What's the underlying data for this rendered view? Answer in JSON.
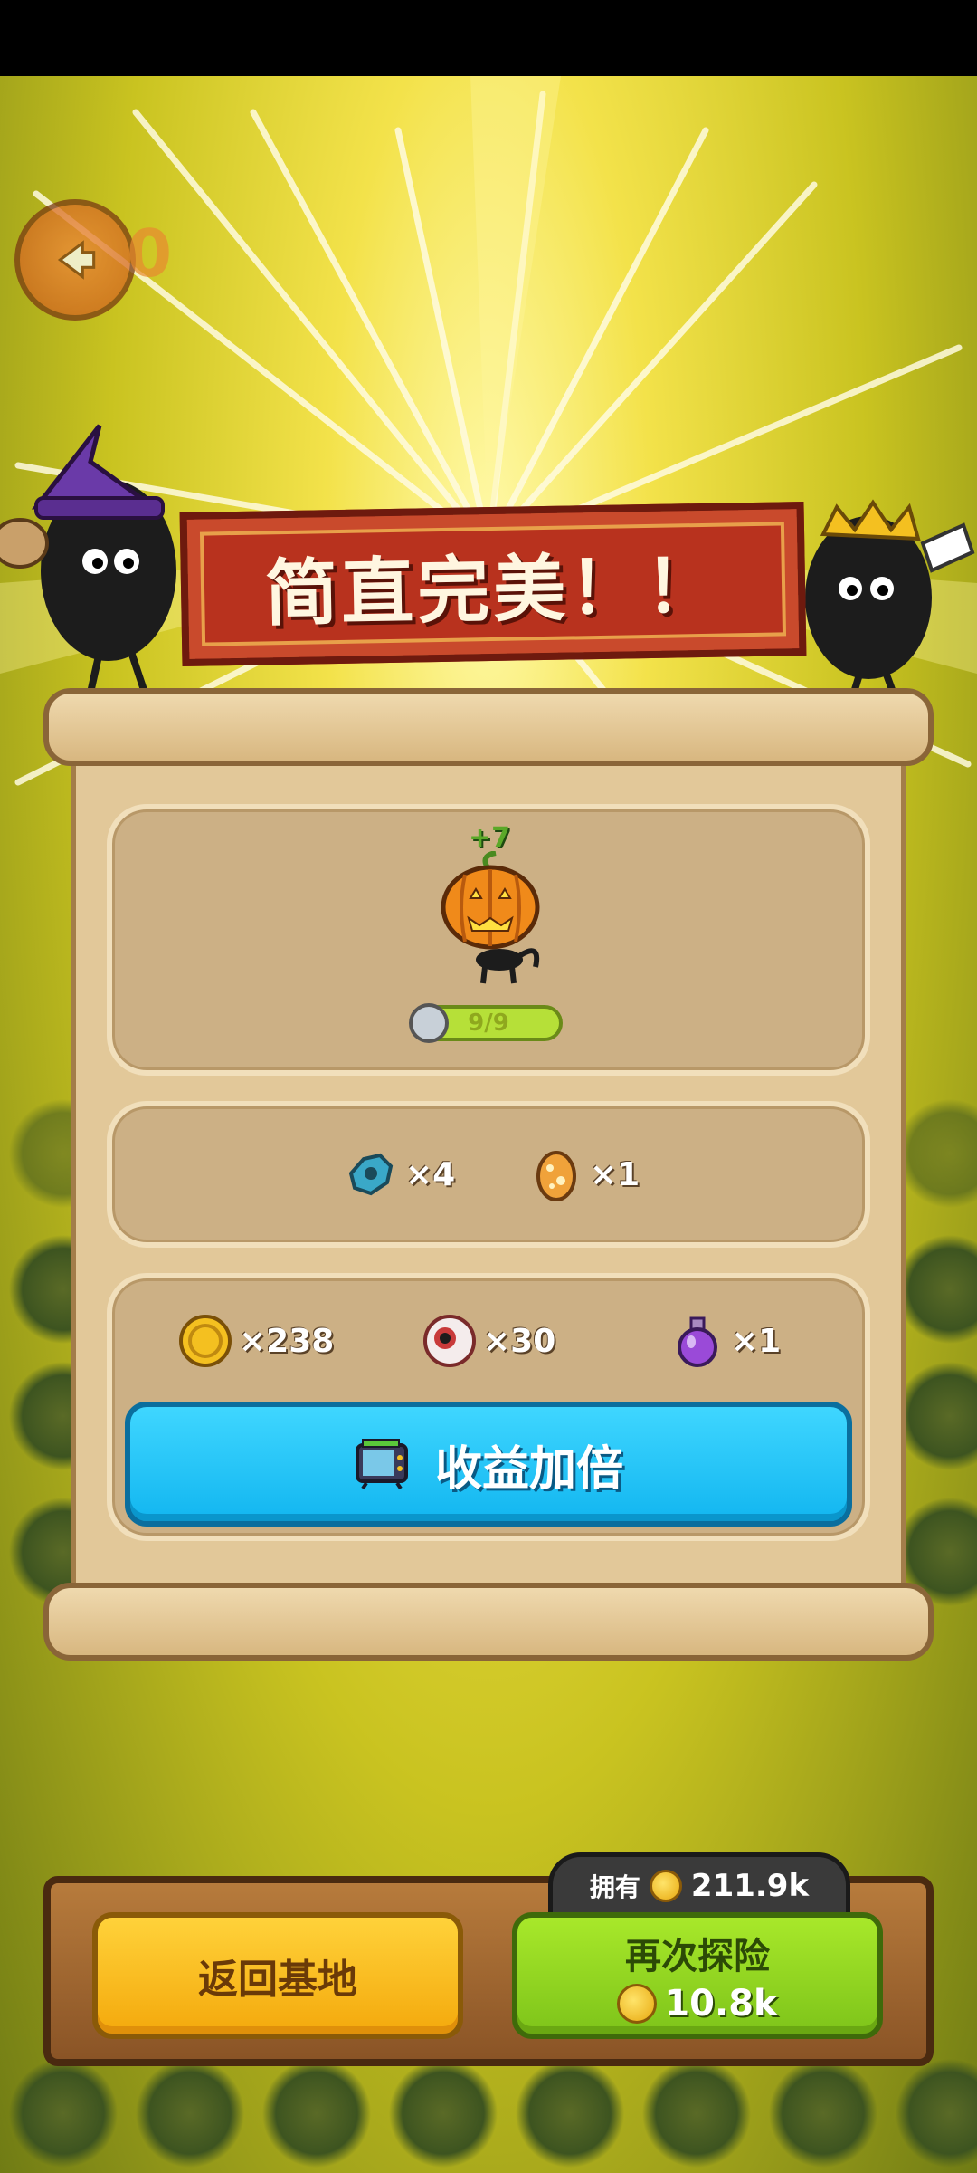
{
  "banner": {
    "title": "简直完美！！"
  },
  "header": {
    "back_icon": "arrow-left-icon",
    "partial_counter": "0"
  },
  "reward": {
    "gain": "+7",
    "hero_icon": "pumpkin-head-cat-icon",
    "hp": "9/9"
  },
  "drops": [
    {
      "icon": "blue-key-fragment-icon",
      "count": "×4"
    },
    {
      "icon": "spotted-egg-icon",
      "count": "×1"
    }
  ],
  "resources": [
    {
      "icon": "gold-coin-icon",
      "count": "×238"
    },
    {
      "icon": "eyeball-icon",
      "count": "×30"
    },
    {
      "icon": "purple-potion-icon",
      "count": "×1"
    }
  ],
  "double_button": {
    "label": "收益加倍",
    "icon": "tv-ad-icon"
  },
  "footer": {
    "return_label": "返回基地",
    "again_label": "再次探险",
    "again_cost": "10.8k",
    "owned_label": "拥有",
    "owned_value": "211.9k"
  },
  "colors": {
    "banner": "#b8321e",
    "double_button": "#12b6f0",
    "return_button": "#f4a90c",
    "again_button": "#7ec41a"
  }
}
